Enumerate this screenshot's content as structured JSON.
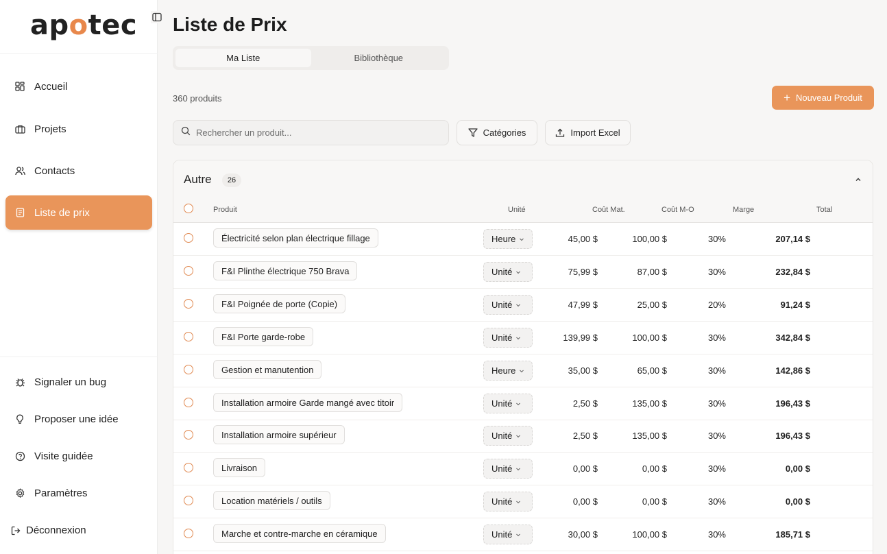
{
  "sidebar": {
    "logo": {
      "pre": "ap",
      "mid": "o",
      "post": "tec"
    },
    "nav": [
      {
        "label": "Accueil",
        "icon": "grid-icon",
        "active": false
      },
      {
        "label": "Projets",
        "icon": "briefcase-icon",
        "active": false
      },
      {
        "label": "Contacts",
        "icon": "users-icon",
        "active": false
      },
      {
        "label": "Liste de prix",
        "icon": "receipt-icon",
        "active": true
      }
    ],
    "bottom": [
      {
        "label": "Signaler un bug",
        "icon": "bug-icon"
      },
      {
        "label": "Proposer une idée",
        "icon": "lightbulb-icon"
      },
      {
        "label": "Visite guidée",
        "icon": "help-circle-icon"
      },
      {
        "label": "Paramètres",
        "icon": "gear-icon"
      },
      {
        "label": "Déconnexion",
        "icon": "logout-icon"
      }
    ]
  },
  "page": {
    "title": "Liste de Prix",
    "tabs": [
      "Ma Liste",
      "Bibliothèque"
    ],
    "active_tab": 0,
    "product_count": "360 produits",
    "new_button": "Nouveau Produit",
    "search_placeholder": "Rechercher un produit...",
    "categories_button": "Catégories",
    "import_button": "Import Excel"
  },
  "group": {
    "name": "Autre",
    "count": "26",
    "columns": {
      "product": "Produit",
      "unit": "Unité",
      "cost_mat": "Coût Mat.",
      "cost_mo": "Coût M-O",
      "margin": "Marge",
      "total": "Total"
    },
    "rows": [
      {
        "name": "Électricité selon plan électrique fillage",
        "unit": "Heure",
        "mat": "45,00 $",
        "mo": "100,00 $",
        "margin": "30%",
        "total": "207,14 $"
      },
      {
        "name": "F&I Plinthe électrique 750 Brava",
        "unit": "Unité",
        "mat": "75,99 $",
        "mo": "87,00 $",
        "margin": "30%",
        "total": "232,84 $"
      },
      {
        "name": "F&I Poignée de porte (Copie)",
        "unit": "Unité",
        "mat": "47,99 $",
        "mo": "25,00 $",
        "margin": "20%",
        "total": "91,24 $"
      },
      {
        "name": "F&I Porte garde-robe",
        "unit": "Unité",
        "mat": "139,99 $",
        "mo": "100,00 $",
        "margin": "30%",
        "total": "342,84 $"
      },
      {
        "name": "Gestion et manutention",
        "unit": "Heure",
        "mat": "35,00 $",
        "mo": "65,00 $",
        "margin": "30%",
        "total": "142,86 $"
      },
      {
        "name": "Installation armoire Garde mangé avec titoir",
        "unit": "Unité",
        "mat": "2,50 $",
        "mo": "135,00 $",
        "margin": "30%",
        "total": "196,43 $"
      },
      {
        "name": "Installation armoire supérieur",
        "unit": "Unité",
        "mat": "2,50 $",
        "mo": "135,00 $",
        "margin": "30%",
        "total": "196,43 $"
      },
      {
        "name": "Livraison",
        "unit": "Unité",
        "mat": "0,00 $",
        "mo": "0,00 $",
        "margin": "30%",
        "total": "0,00 $"
      },
      {
        "name": "Location matériels / outils",
        "unit": "Unité",
        "mat": "0,00 $",
        "mo": "0,00 $",
        "margin": "30%",
        "total": "0,00 $"
      },
      {
        "name": "Marche et contre-marche en céramique",
        "unit": "Unité",
        "mat": "30,00 $",
        "mo": "100,00 $",
        "margin": "30%",
        "total": "185,71 $"
      }
    ]
  },
  "colors": {
    "accent": "#e9955a",
    "radio": "#e0884f"
  }
}
